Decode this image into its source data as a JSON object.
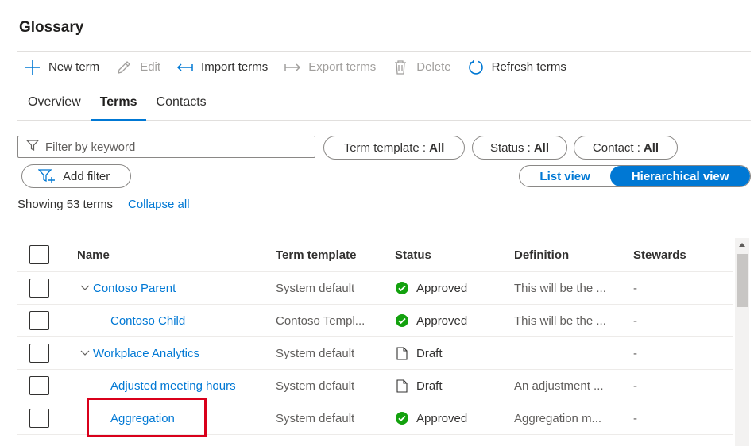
{
  "page_title": "Glossary",
  "toolbar": {
    "new_term": "New term",
    "edit": "Edit",
    "import_terms": "Import terms",
    "export_terms": "Export terms",
    "delete": "Delete",
    "refresh_terms": "Refresh terms"
  },
  "tabs": [
    {
      "label": "Overview",
      "active": false
    },
    {
      "label": "Terms",
      "active": true
    },
    {
      "label": "Contacts",
      "active": false
    }
  ],
  "filter": {
    "placeholder": "Filter by keyword",
    "term_template_label": "Term template :",
    "term_template_value": "All",
    "status_label": "Status :",
    "status_value": "All",
    "contact_label": "Contact :",
    "contact_value": "All",
    "add_filter": "Add filter"
  },
  "view_toggle": {
    "list_view": "List view",
    "hierarchical_view": "Hierarchical view",
    "selected": "Hierarchical view"
  },
  "summary": {
    "showing": "Showing 53 terms",
    "collapse_all": "Collapse all"
  },
  "table": {
    "headers": {
      "name": "Name",
      "term_template": "Term template",
      "status": "Status",
      "definition": "Definition",
      "stewards": "Stewards"
    },
    "rows": [
      {
        "name": "Contoso Parent",
        "level": 0,
        "expandable": true,
        "term_template": "System default",
        "status": "Approved",
        "status_icon": "check-circle-icon",
        "definition": "This will be the ...",
        "stewards": "-"
      },
      {
        "name": "Contoso Child",
        "level": 1,
        "expandable": false,
        "term_template": "Contoso Templ...",
        "status": "Approved",
        "status_icon": "check-circle-icon",
        "definition": "This will be the ...",
        "stewards": "-"
      },
      {
        "name": "Workplace Analytics",
        "level": 0,
        "expandable": true,
        "term_template": "System default",
        "status": "Draft",
        "status_icon": "document-icon",
        "definition": "",
        "stewards": "-"
      },
      {
        "name": "Adjusted meeting hours",
        "level": 1,
        "expandable": false,
        "term_template": "System default",
        "status": "Draft",
        "status_icon": "document-icon",
        "definition": "An adjustment ...",
        "stewards": "-"
      },
      {
        "name": "Aggregation",
        "level": 1,
        "expandable": false,
        "term_template": "System default",
        "status": "Approved",
        "status_icon": "check-circle-icon",
        "definition": "Aggregation m...",
        "stewards": "-"
      }
    ]
  },
  "colors": {
    "accent": "#0078d4",
    "approved_green": "#13a10e",
    "highlight_red": "#d9001b"
  }
}
